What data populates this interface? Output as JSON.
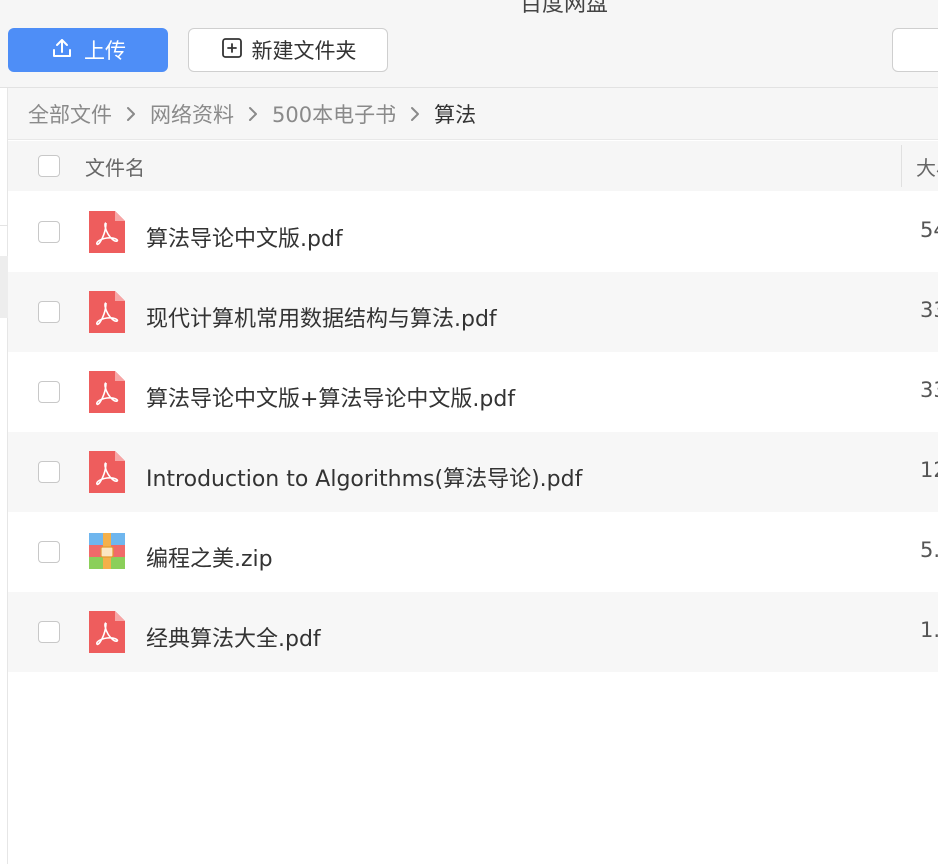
{
  "window": {
    "title": "百度网盘"
  },
  "toolbar": {
    "upload_label": "上传",
    "upload_icon": "upload-icon",
    "new_folder_label": "新建文件夹",
    "new_folder_icon": "folder-plus-icon"
  },
  "breadcrumb": {
    "items": [
      "全部文件",
      "网络资料",
      "500本电子书",
      "算法"
    ]
  },
  "table": {
    "headers": {
      "name": "文件名",
      "size": "大小"
    },
    "rows": [
      {
        "name": "算法导论中文版.pdf",
        "size": "54",
        "type": "pdf"
      },
      {
        "name": "现代计算机常用数据结构与算法.pdf",
        "size": "33",
        "type": "pdf"
      },
      {
        "name": "算法导论中文版+算法导论中文版.pdf",
        "size": "33",
        "type": "pdf"
      },
      {
        "name": "Introduction to Algorithms(算法导论).pdf",
        "size": "12",
        "type": "pdf"
      },
      {
        "name": "编程之美.zip",
        "size": "5.",
        "type": "zip"
      },
      {
        "name": "经典算法大全.pdf",
        "size": "1.",
        "type": "pdf"
      }
    ]
  },
  "colors": {
    "accent": "#4e8ef7",
    "pdf_red": "#ee5d5d",
    "zip_blue": "#6fb6ee",
    "zip_red": "#f06a6a",
    "zip_green": "#8bcf5a",
    "zip_orange": "#f4b04a"
  }
}
